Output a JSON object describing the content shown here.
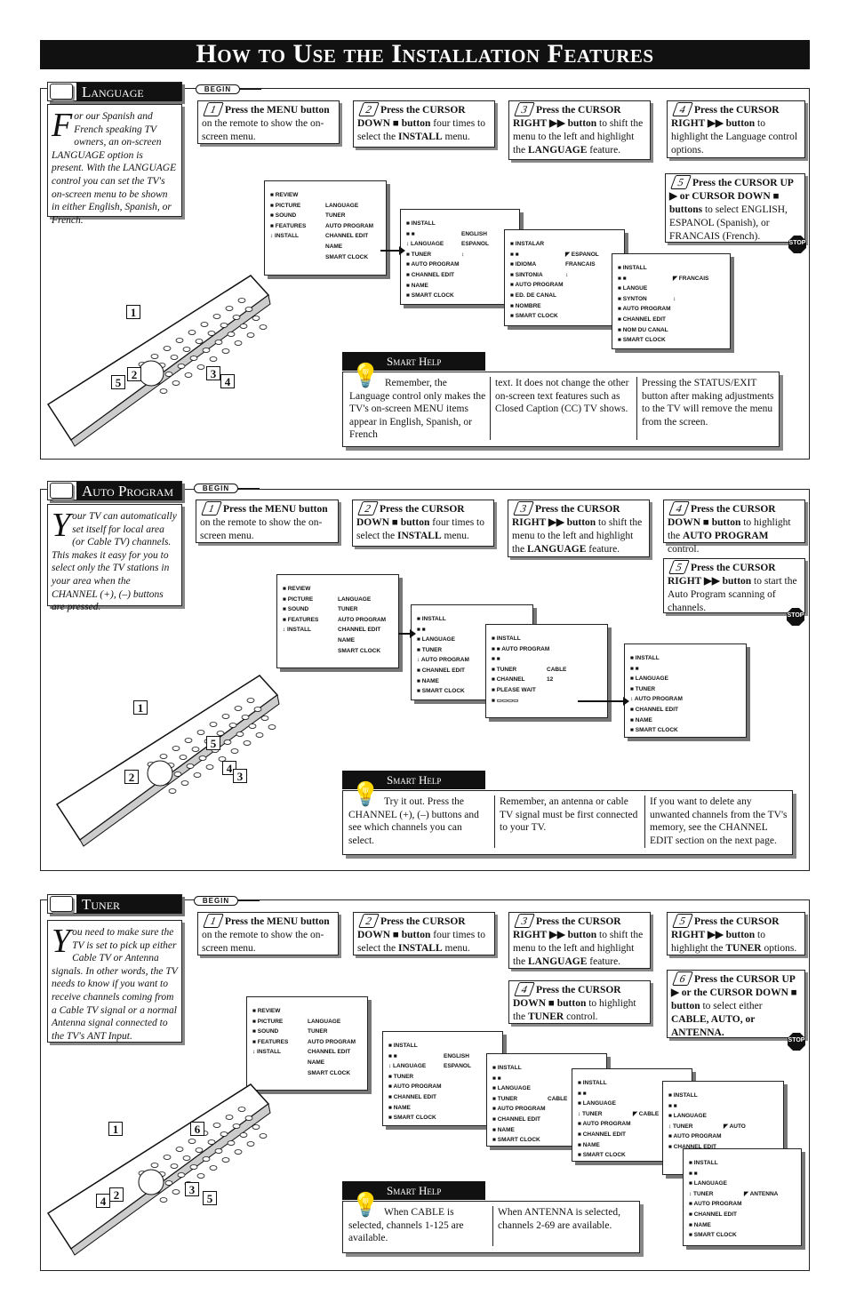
{
  "header": {
    "title": "How to Use the Installation Features"
  },
  "begin_label": "BEGIN",
  "stop_label": "STOP",
  "smart_help_label": "Smart Help",
  "sections": [
    {
      "title": "Language",
      "intro_drop": "F",
      "intro": "or our Spanish and French speaking TV owners, an on-screen LANGUAGE option is present. With the LANGUAGE control you can set the TV's on-screen menu to be shown in either English, Spanish, or French.",
      "steps": [
        {
          "n": "1",
          "parts": [
            {
              "b": "Press the MENU button"
            },
            {
              "t": " on the remote to show the on-screen menu."
            }
          ]
        },
        {
          "n": "2",
          "parts": [
            {
              "b": "Press the CURSOR DOWN ■ button"
            },
            {
              "t": " four times to select the "
            },
            {
              "b": "INSTALL"
            },
            {
              "t": " menu."
            }
          ]
        },
        {
          "n": "3",
          "parts": [
            {
              "b": "Press the CURSOR RIGHT ▶▶ button"
            },
            {
              "t": " to shift the menu to the left and highlight the "
            },
            {
              "b": "LANGUAGE"
            },
            {
              "t": " feature."
            }
          ]
        },
        {
          "n": "4",
          "parts": [
            {
              "b": "Press the CURSOR RIGHT ▶▶ button"
            },
            {
              "t": " to highlight the Language control options."
            }
          ]
        },
        {
          "n": "5",
          "parts": [
            {
              "b": "Press the CURSOR UP ▶ or CURSOR DOWN ■ buttons"
            },
            {
              "t": " to select ENGLISH, ESPANOL (Spanish), or FRANCAIS (French)."
            }
          ]
        }
      ],
      "menus": [
        [
          [
            "■ REVIEW",
            ""
          ],
          [
            "■ PICTURE",
            "LANGUAGE"
          ],
          [
            "■ SOUND",
            "TUNER"
          ],
          [
            "■ FEATURES",
            "AUTO PROGRAM"
          ],
          [
            "↕ INSTALL",
            "CHANNEL EDIT"
          ],
          [
            "",
            "NAME"
          ],
          [
            "",
            "SMART CLOCK"
          ]
        ],
        [
          [
            "■ INSTALL",
            ""
          ],
          [
            "■ ■",
            "ENGLISH"
          ],
          [
            "↕ LANGUAGE",
            "ESPANOL"
          ],
          [
            "■ TUNER",
            "↕"
          ],
          [
            "■ AUTO PROGRAM",
            ""
          ],
          [
            "■ CHANNEL EDIT",
            ""
          ],
          [
            "■ NAME",
            ""
          ],
          [
            "■ SMART CLOCK",
            ""
          ]
        ],
        [
          [
            "■ INSTALAR",
            ""
          ],
          [
            "■ ■",
            "◤ ESPANOL"
          ],
          [
            "■ IDIOMA",
            "FRANCAIS"
          ],
          [
            "■ SINTONIA",
            "↕"
          ],
          [
            "■ AUTO PROGRAM",
            ""
          ],
          [
            "■ ED. DE CANAL",
            ""
          ],
          [
            "■ NOMBRE",
            ""
          ],
          [
            "■ SMART CLOCK",
            ""
          ]
        ],
        [
          [
            "■ INSTALL",
            ""
          ],
          [
            "■ ■",
            "◤ FRANCAIS"
          ],
          [
            "■ LANGUE",
            ""
          ],
          [
            "■ SYNTON",
            "↕"
          ],
          [
            "■ AUTO PROGRAM",
            ""
          ],
          [
            "■ CHANNEL EDIT",
            ""
          ],
          [
            "■ NOM DU CANAL",
            ""
          ],
          [
            "■ SMART CLOCK",
            ""
          ]
        ]
      ],
      "help": [
        "Remember, the Language control only makes the TV's on-screen MENU items appear in English, Spanish, or French",
        "text. It does not change the other on-screen text features such as Closed Caption (CC) TV shows.",
        "Pressing the STATUS/EXIT button after making adjustments to the TV will remove the menu from the screen."
      ],
      "callouts": [
        "1",
        "2",
        "5",
        "3",
        "4"
      ]
    },
    {
      "title": "Auto Program",
      "intro_drop": "Y",
      "intro": "our TV can automatically set itself for local area (or Cable TV) channels. This makes it easy for you to select only the TV stations in your area when the CHANNEL (+), (–) buttons are pressed.",
      "steps": [
        {
          "n": "1",
          "parts": [
            {
              "b": "Press the MENU button"
            },
            {
              "t": " on the remote to show the on-screen menu."
            }
          ]
        },
        {
          "n": "2",
          "parts": [
            {
              "b": "Press the CURSOR DOWN ■ button"
            },
            {
              "t": " four times to select the "
            },
            {
              "b": "INSTALL"
            },
            {
              "t": " menu."
            }
          ]
        },
        {
          "n": "3",
          "parts": [
            {
              "b": "Press the CURSOR RIGHT ▶▶ button"
            },
            {
              "t": " to shift the menu to the left and highlight the "
            },
            {
              "b": "LANGUAGE"
            },
            {
              "t": " feature."
            }
          ]
        },
        {
          "n": "4",
          "parts": [
            {
              "b": "Press the CURSOR DOWN ■ button"
            },
            {
              "t": " to highlight the "
            },
            {
              "b": "AUTO PROGRAM"
            },
            {
              "t": " control."
            }
          ]
        },
        {
          "n": "5",
          "parts": [
            {
              "b": "Press the CURSOR RIGHT ▶▶ button"
            },
            {
              "t": " to start the Auto Program scanning of channels."
            }
          ]
        }
      ],
      "menus": [
        [
          [
            "■ REVIEW",
            ""
          ],
          [
            "■ PICTURE",
            "LANGUAGE"
          ],
          [
            "■ SOUND",
            "TUNER"
          ],
          [
            "■ FEATURES",
            "AUTO PROGRAM"
          ],
          [
            "↕ INSTALL",
            "CHANNEL EDIT"
          ],
          [
            "",
            "NAME"
          ],
          [
            "",
            "SMART CLOCK"
          ]
        ],
        [
          [
            "■ INSTALL",
            ""
          ],
          [
            "■ ■",
            ""
          ],
          [
            "■ LANGUAGE",
            ""
          ],
          [
            "■ TUNER",
            ""
          ],
          [
            "↕ AUTO PROGRAM",
            ""
          ],
          [
            "■ CHANNEL EDIT",
            ""
          ],
          [
            "■ NAME",
            ""
          ],
          [
            "■ SMART CLOCK",
            ""
          ]
        ],
        [
          [
            "■ INSTALL",
            ""
          ],
          [
            "■ ■ AUTO PROGRAM",
            ""
          ],
          [
            "■ ■",
            ""
          ],
          [
            "■ TUNER",
            "CABLE"
          ],
          [
            "■ CHANNEL",
            "12"
          ],
          [
            "■ PLEASE WAIT",
            ""
          ],
          [
            "■ ▭▭▭▭",
            ""
          ]
        ],
        [
          [
            "■ INSTALL",
            ""
          ],
          [
            "■ ■",
            ""
          ],
          [
            "■ LANGUAGE",
            ""
          ],
          [
            "■ TUNER",
            ""
          ],
          [
            "↕ AUTO PROGRAM",
            ""
          ],
          [
            "■ CHANNEL EDIT",
            ""
          ],
          [
            "■ NAME",
            ""
          ],
          [
            "■ SMART CLOCK",
            ""
          ]
        ]
      ],
      "help": [
        "Try it out. Press the CHANNEL (+), (–) buttons and see which channels you can select.",
        "Remember, an antenna or cable TV signal must be first connected to your TV.",
        "If you want to delete any unwanted channels from the TV's memory, see the CHANNEL EDIT section on the next page."
      ],
      "callouts": [
        "1",
        "2",
        "4",
        "3",
        "5"
      ]
    },
    {
      "title": "Tuner",
      "intro_drop": "Y",
      "intro": "ou need to make sure the TV is set to pick up either Cable TV or Antenna signals. In other words, the TV needs to know if you want to receive channels coming from a Cable TV signal or a normal Antenna signal connected to the TV's ANT Input.",
      "steps": [
        {
          "n": "1",
          "parts": [
            {
              "b": "Press the MENU button"
            },
            {
              "t": " on the remote to show the on-screen menu."
            }
          ]
        },
        {
          "n": "2",
          "parts": [
            {
              "b": "Press the CURSOR DOWN ■ button"
            },
            {
              "t": " four times to select the "
            },
            {
              "b": "INSTALL"
            },
            {
              "t": " menu."
            }
          ]
        },
        {
          "n": "3",
          "parts": [
            {
              "b": "Press the CURSOR RIGHT ▶▶ button"
            },
            {
              "t": " to shift the menu to the left and highlight the "
            },
            {
              "b": "LANGUAGE"
            },
            {
              "t": " feature."
            }
          ]
        },
        {
          "n": "4",
          "parts": [
            {
              "b": "Press the CURSOR DOWN ■ button"
            },
            {
              "t": " to highlight the "
            },
            {
              "b": "TUNER"
            },
            {
              "t": " control."
            }
          ]
        },
        {
          "n": "5",
          "parts": [
            {
              "b": "Press the CURSOR RIGHT ▶▶ button"
            },
            {
              "t": " to highlight the "
            },
            {
              "b": "TUNER"
            },
            {
              "t": " options."
            }
          ]
        },
        {
          "n": "6",
          "parts": [
            {
              "b": "Press the CURSOR UP ▶ or the CURSOR DOWN ■ button"
            },
            {
              "t": " to select either "
            },
            {
              "b": "CABLE, AUTO, or ANTENNA."
            }
          ]
        }
      ],
      "menus": [
        [
          [
            "■ REVIEW",
            ""
          ],
          [
            "■ PICTURE",
            "LANGUAGE"
          ],
          [
            "■ SOUND",
            "TUNER"
          ],
          [
            "■ FEATURES",
            "AUTO PROGRAM"
          ],
          [
            "↕ INSTALL",
            "CHANNEL EDIT"
          ],
          [
            "",
            "NAME"
          ],
          [
            "",
            "SMART CLOCK"
          ]
        ],
        [
          [
            "■ INSTALL",
            ""
          ],
          [
            "■ ■",
            "ENGLISH"
          ],
          [
            "↕ LANGUAGE",
            "ESPANOL"
          ],
          [
            "■ TUNER",
            ""
          ],
          [
            "■ AUTO PROGRAM",
            ""
          ],
          [
            "■ CHANNEL EDIT",
            ""
          ],
          [
            "■ NAME",
            ""
          ],
          [
            "■ SMART CLOCK",
            ""
          ]
        ],
        [
          [
            "■ INSTALL",
            ""
          ],
          [
            "■ ■",
            ""
          ],
          [
            "■ LANGUAGE",
            ""
          ],
          [
            "■ TUNER",
            "CABLE"
          ],
          [
            "■ AUTO PROGRAM",
            ""
          ],
          [
            "■ CHANNEL EDIT",
            ""
          ],
          [
            "■ NAME",
            ""
          ],
          [
            "■ SMART CLOCK",
            ""
          ]
        ],
        [
          [
            "■ INSTALL",
            ""
          ],
          [
            "■ ■",
            ""
          ],
          [
            "■ LANGUAGE",
            ""
          ],
          [
            "↕ TUNER",
            "◤ CABLE"
          ],
          [
            "■ AUTO PROGRAM",
            ""
          ],
          [
            "■ CHANNEL EDIT",
            ""
          ],
          [
            "■ NAME",
            ""
          ],
          [
            "■ SMART CLOCK",
            ""
          ]
        ],
        [
          [
            "■ INSTALL",
            ""
          ],
          [
            "■ ■",
            ""
          ],
          [
            "■ LANGUAGE",
            ""
          ],
          [
            "↕ TUNER",
            "◤ AUTO"
          ],
          [
            "■ AUTO PROGRAM",
            ""
          ],
          [
            "■ CHANNEL EDIT",
            ""
          ]
        ],
        [
          [
            "■ INSTALL",
            ""
          ],
          [
            "■ ■",
            ""
          ],
          [
            "■ LANGUAGE",
            ""
          ],
          [
            "↕ TUNER",
            "◤ ANTENNA"
          ],
          [
            "■ AUTO PROGRAM",
            ""
          ],
          [
            "■ CHANNEL EDIT",
            ""
          ],
          [
            "■ NAME",
            ""
          ],
          [
            "■ SMART CLOCK",
            ""
          ]
        ]
      ],
      "help": [
        "When CABLE is selected, channels 1-125 are available.",
        "When ANTENNA is selected, channels 2-69 are available."
      ],
      "callouts": [
        "1",
        "2",
        "4",
        "6",
        "3",
        "5"
      ]
    }
  ]
}
